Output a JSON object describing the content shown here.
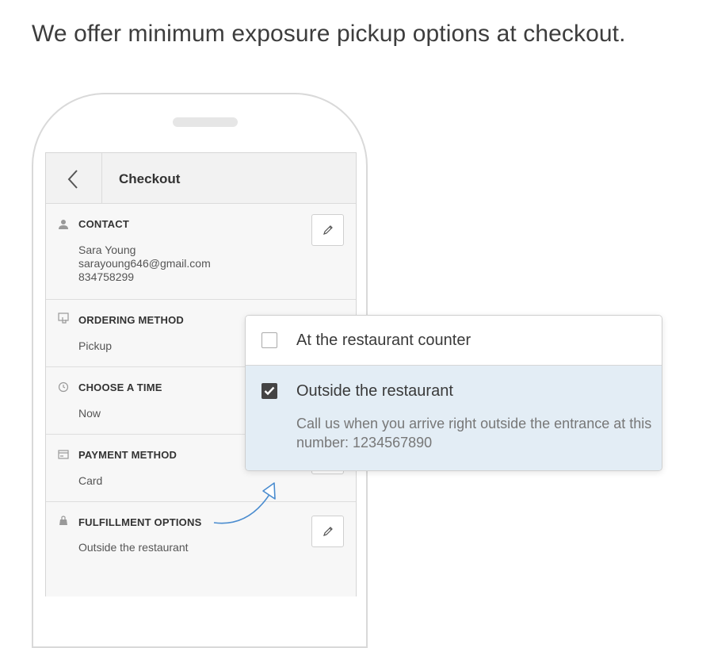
{
  "headline": "We offer minimum exposure pickup options at checkout.",
  "screen": {
    "title": "Checkout",
    "contact": {
      "title": "CONTACT",
      "name": "Sara Young",
      "email": "sarayoung646@gmail.com",
      "phone": "834758299",
      "icon": "person-icon"
    },
    "ordering": {
      "title": "ORDERING METHOD",
      "value": "Pickup",
      "icon": "tap-icon"
    },
    "time": {
      "title": "CHOOSE A TIME",
      "value": "Now",
      "icon": "clock-icon"
    },
    "payment": {
      "title": "PAYMENT METHOD",
      "value": "Card",
      "icon": "card-icon"
    },
    "fulfillment": {
      "title": "FULFILLMENT OPTIONS",
      "value": "Outside the restaurant",
      "icon": "bag-icon"
    }
  },
  "popup": {
    "option1": {
      "label": "At the restaurant counter",
      "checked": false
    },
    "option2": {
      "label": "Outside the restaurant",
      "checked": true,
      "description": "Call us when you arrive right outside the entrance at this number: 1234567890"
    }
  },
  "colors": {
    "accent": "#4a8ccf",
    "selected_bg": "#e3edf5",
    "checkbox": "#444444"
  }
}
